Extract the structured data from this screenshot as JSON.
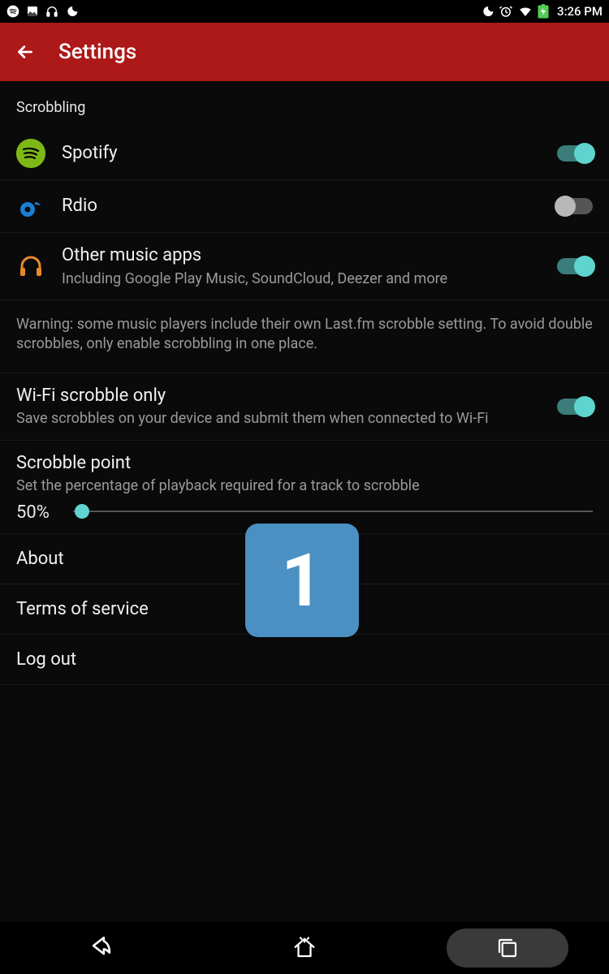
{
  "status": {
    "time": "3:26 PM"
  },
  "appbar": {
    "title": "Settings"
  },
  "section_header": "Scrobbling",
  "rows": {
    "spotify": {
      "title": "Spotify",
      "on": true
    },
    "rdio": {
      "title": "Rdio",
      "on": false
    },
    "other": {
      "title": "Other music apps",
      "sub": "Including Google Play Music, SoundCloud, Deezer and more",
      "on": true
    }
  },
  "warning": "Warning: some music players include their own Last.fm scrobble setting. To avoid double scrobbles, only enable scrobbling in one place.",
  "wifi": {
    "title": "Wi-Fi scrobble only",
    "sub": "Save scrobbles on your device and submit them when connected to Wi-Fi",
    "on": true
  },
  "scrobble_point": {
    "title": "Scrobble point",
    "sub": "Set the percentage of playback required for a track to scrobble",
    "value_label": "50%",
    "value": 50
  },
  "links": {
    "about": "About",
    "terms": "Terms of service",
    "logout": "Log out"
  },
  "overlay": {
    "label": "1"
  }
}
